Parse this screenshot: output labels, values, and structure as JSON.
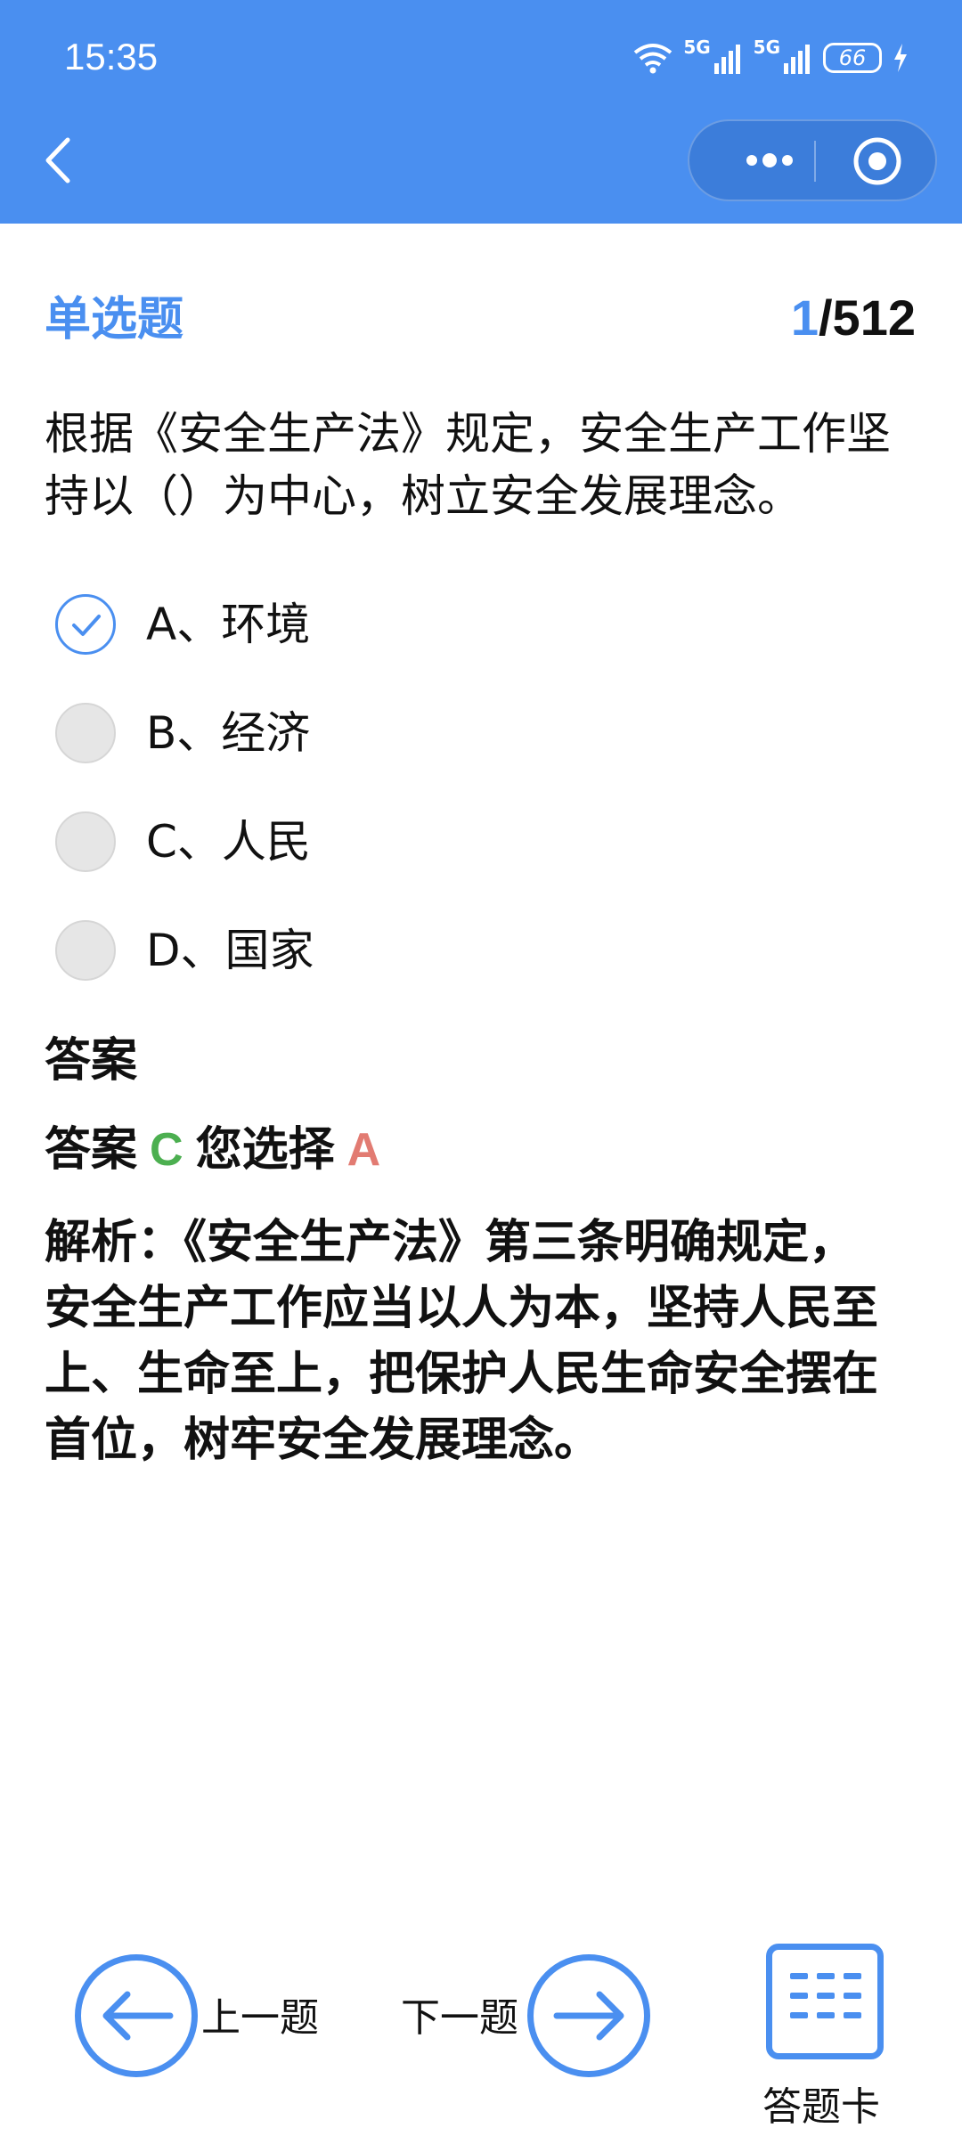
{
  "status_bar": {
    "time": "15:35",
    "signal_1": "5G",
    "signal_2": "5G",
    "battery": "66"
  },
  "header": {
    "back_icon": "chevron-left-icon",
    "more_icon": "more-dots-icon",
    "close_icon": "target-circle-icon",
    "color": "#4a8ff0"
  },
  "question": {
    "type": "单选题",
    "current": "1",
    "total": "/512",
    "text": "根据《安全生产法》规定，安全生产工作坚持以（）为中心，树立安全发展理念。",
    "options": [
      {
        "label": "A、环境",
        "checked": true
      },
      {
        "label": "B、经济",
        "checked": false
      },
      {
        "label": "C、人民",
        "checked": false
      },
      {
        "label": "D、国家",
        "checked": false
      }
    ]
  },
  "answer": {
    "title": "答案",
    "prefix": "答案",
    "correct": "C",
    "your_choice_label": "您选择",
    "your_choice": "A",
    "correct_color": "#4caf50",
    "wrong_color": "#e27b72",
    "analysis": "解析：《安全生产法》第三条明确规定，安全生产工作应当以人为本，坚持人民至上、生命至上，把保护人民生命安全摆在首位，树牢安全发展理念。"
  },
  "bottom_nav": {
    "prev_label": "上一题",
    "next_label": "下一题",
    "card_label": "答题卡"
  }
}
